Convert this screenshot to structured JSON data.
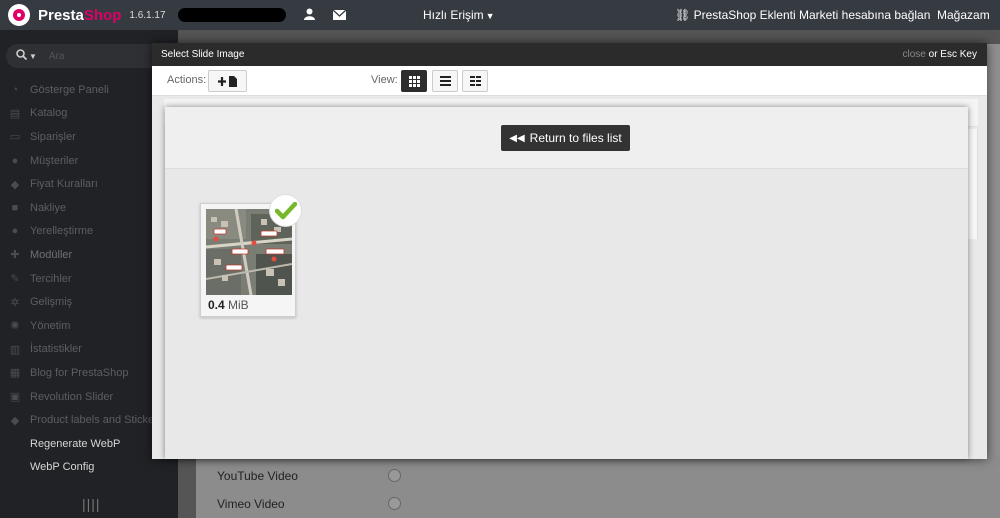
{
  "topbar": {
    "brand_part1": "Presta",
    "brand_part2": "Shop",
    "version": "1.6.1.17",
    "quick_access": "Hızlı Erişim",
    "addons_link": "PrestaShop Eklenti Marketi hesabına bağlan",
    "store_link": "Mağazam"
  },
  "sidebar": {
    "search_placeholder": "Ara",
    "items": [
      {
        "label": "Gösterge Paneli",
        "icon": "dashboard-icon"
      },
      {
        "label": "Katalog",
        "icon": "catalog-icon"
      },
      {
        "label": "Siparişler",
        "icon": "orders-icon"
      },
      {
        "label": "Müşteriler",
        "icon": "customers-icon"
      },
      {
        "label": "Fiyat Kuralları",
        "icon": "tag-icon"
      },
      {
        "label": "Nakliye",
        "icon": "truck-icon"
      },
      {
        "label": "Yerelleştirme",
        "icon": "globe-icon"
      },
      {
        "label": "Modüller",
        "icon": "puzzle-icon"
      },
      {
        "label": "Tercihler",
        "icon": "wrench-icon"
      },
      {
        "label": "Gelişmiş",
        "icon": "cogs-icon"
      },
      {
        "label": "Yönetim",
        "icon": "cog-icon"
      },
      {
        "label": "İstatistikler",
        "icon": "chart-icon"
      },
      {
        "label": "Blog for PrestaShop",
        "icon": "blog-icon"
      },
      {
        "label": "Revolution Slider",
        "icon": "slider-icon"
      },
      {
        "label": "Product labels and Stickers",
        "icon": "tag-icon"
      },
      {
        "label": "Regenerate WebP",
        "icon": ""
      },
      {
        "label": "WebP Config",
        "icon": ""
      }
    ]
  },
  "background": {
    "options": [
      "YouTube Video",
      "Vimeo Video"
    ]
  },
  "modal": {
    "title": "Select Slide Image",
    "close_text": "close",
    "close_or": " or Esc Key",
    "actions_label": "Actions:",
    "view_label": "View:",
    "return_button": "Return to files list",
    "file": {
      "size_value": "0.4",
      "size_unit": " MiB"
    }
  },
  "colors": {
    "topbar": "#363a41",
    "brand_accent": "#df0067",
    "sidebar": "#202226",
    "check": "#77b82a"
  }
}
